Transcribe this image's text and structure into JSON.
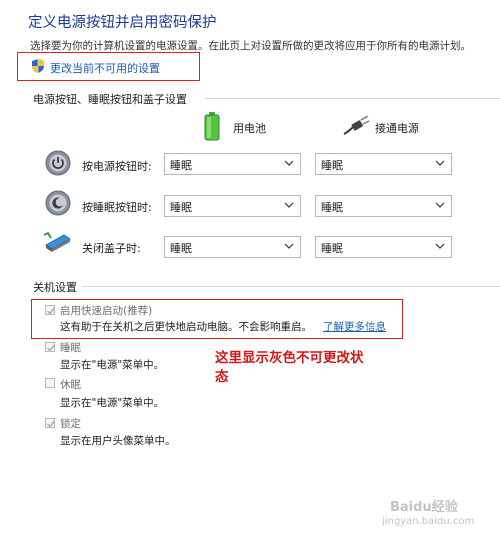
{
  "header": {
    "title": "定义电源按钮并启用密码保护",
    "description": "选择要为你的计算机设置的电源设置。在此页上对设置所做的更改将应用于你所有的电源计划。",
    "change_link": "更改当前不可用的设置"
  },
  "power_buttons": {
    "section_title": "电源按钮、睡眠按钮和盖子设置",
    "col_battery": "用电池",
    "col_plugged": "接通电源",
    "rows": [
      {
        "label": "按电源按钮时:",
        "battery": "睡眠",
        "plugged": "睡眠",
        "icon": "power-button-icon"
      },
      {
        "label": "按睡眠按钮时:",
        "battery": "睡眠",
        "plugged": "睡眠",
        "icon": "sleep-button-icon"
      },
      {
        "label": "关闭盖子时:",
        "battery": "睡眠",
        "plugged": "睡眠",
        "icon": "laptop-lid-icon"
      }
    ]
  },
  "shutdown": {
    "section_title": "关机设置",
    "items": [
      {
        "label": "启用快速启动(推荐)",
        "desc": "这有助于在关机之后更快地启动电脑。不会影响重启。",
        "link": "了解更多信息",
        "checked": true
      },
      {
        "label": "睡眠",
        "desc": "显示在\"电源\"菜单中。",
        "checked": true
      },
      {
        "label": "休眠",
        "desc": "显示在\"电源\"菜单中。",
        "checked": false
      },
      {
        "label": "锁定",
        "desc": "显示在用户头像菜单中。",
        "checked": true
      }
    ]
  },
  "annotation": {
    "line1": "这里显示灰色不可更改状",
    "line2": "态"
  },
  "watermark": {
    "brand": "Baidu经验",
    "url": "jingyan.baidu.com"
  },
  "colors": {
    "title_blue": "#1a3a9a",
    "link_blue": "#1a5fb4",
    "highlight_red": "#d9231f"
  }
}
